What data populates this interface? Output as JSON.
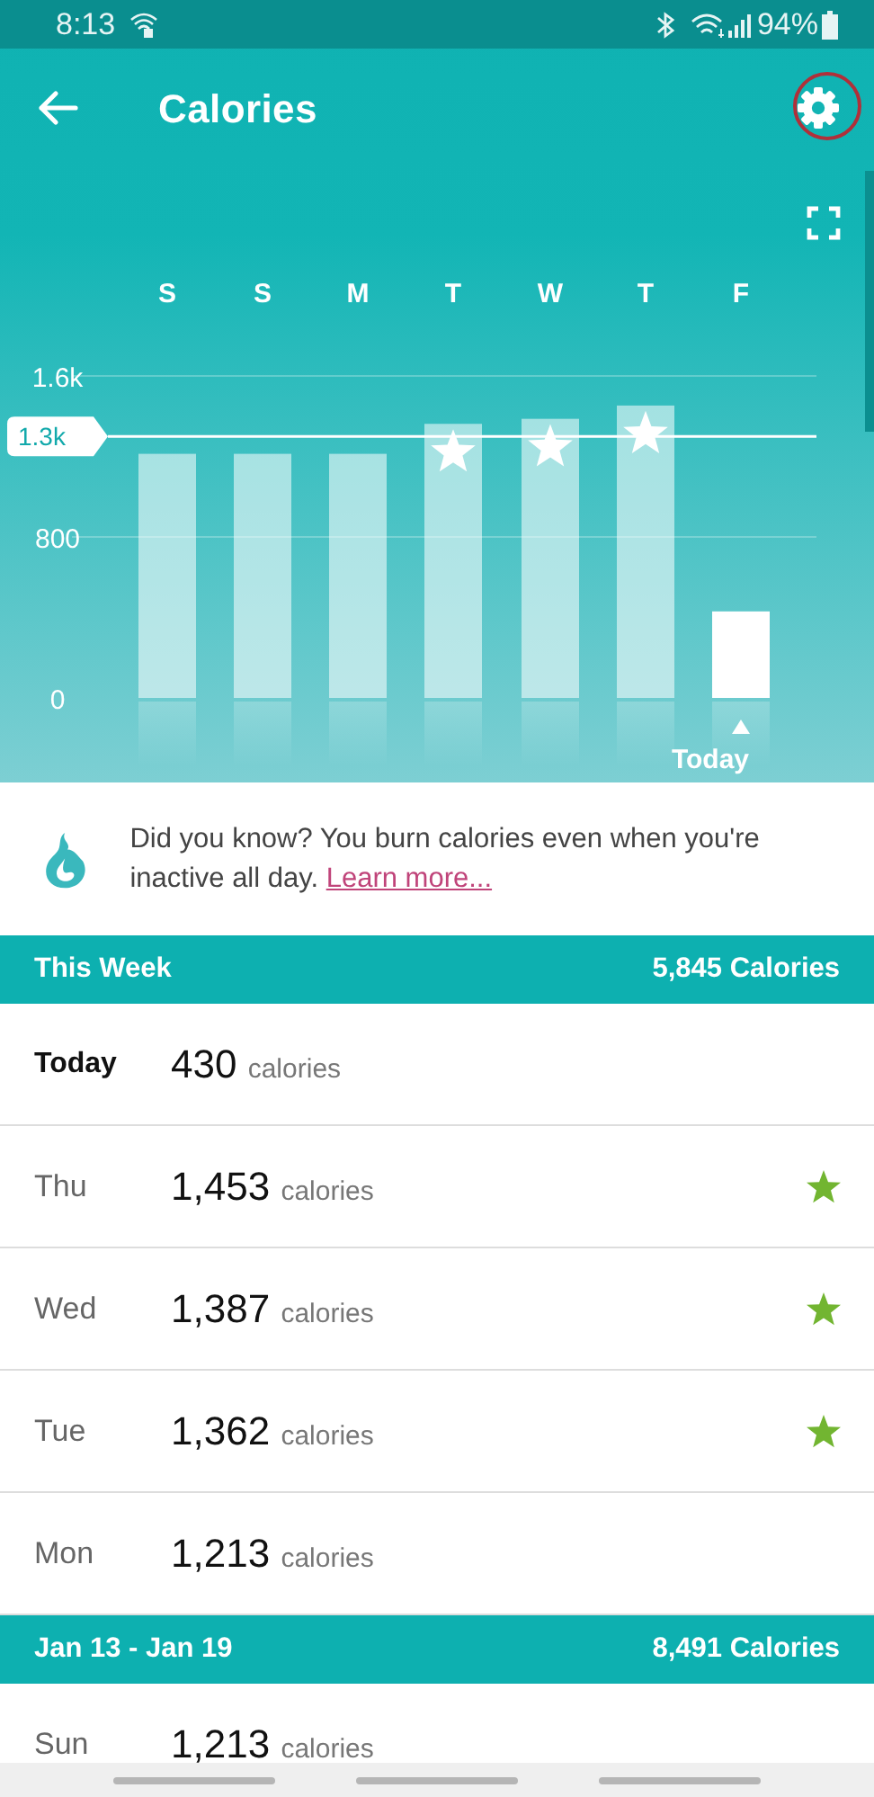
{
  "status_bar": {
    "time": "8:13",
    "battery": "94%"
  },
  "header": {
    "title": "Calories"
  },
  "chart": {
    "today_label": "Today",
    "days": [
      {
        "selected": false,
        "goal_met": false
      },
      {
        "selected": false,
        "goal_met": false
      },
      {
        "selected": false,
        "goal_met": false
      },
      {
        "selected": false,
        "goal_met": true
      },
      {
        "selected": false,
        "goal_met": true
      },
      {
        "selected": false,
        "goal_met": true
      },
      {
        "selected": true,
        "goal_met": false
      }
    ],
    "chart_data": {
      "type": "bar",
      "categories": [
        "S",
        "S",
        "M",
        "T",
        "W",
        "T",
        "F"
      ],
      "values": [
        1213,
        1213,
        1213,
        1362,
        1387,
        1453,
        430
      ],
      "ylim": [
        0,
        1600
      ],
      "yticks": [
        0,
        800,
        {
          "value": 1600,
          "label": "1.6k"
        }
      ],
      "ref_lines": [
        {
          "axis": "y",
          "value": 1300,
          "label": "1.3k"
        }
      ]
    }
  },
  "tip": {
    "text": "Did you know? You burn calories even when you're inactive all day.",
    "link": "Learn more..."
  },
  "sections": [
    {
      "title": "This Week",
      "total": "5,845 Calories",
      "rows": [
        {
          "kind": "today",
          "day": "Today",
          "value": "430",
          "unit": "calories",
          "goal_met": false
        },
        {
          "kind": "day",
          "day": "Thu",
          "value": "1,453",
          "unit": "calories",
          "goal_met": true
        },
        {
          "kind": "day",
          "day": "Wed",
          "value": "1,387",
          "unit": "calories",
          "goal_met": true
        },
        {
          "kind": "day",
          "day": "Tue",
          "value": "1,362",
          "unit": "calories",
          "goal_met": true
        },
        {
          "kind": "day",
          "day": "Mon",
          "value": "1,213",
          "unit": "calories",
          "goal_met": false
        }
      ]
    },
    {
      "title": "Jan 13 - Jan 19",
      "total": "8,491 Calories",
      "rows": [
        {
          "kind": "day",
          "day": "Sun",
          "value": "1,213",
          "unit": "calories",
          "goal_met": false
        }
      ]
    }
  ]
}
